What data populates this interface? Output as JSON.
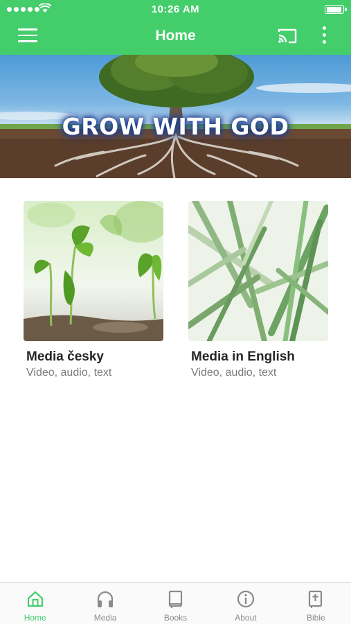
{
  "status_bar": {
    "time": "10:26 AM"
  },
  "header": {
    "title": "Home",
    "menu_icon": "hamburger-icon",
    "cast_icon": "cast-icon",
    "more_icon": "more-vertical-icon"
  },
  "banner": {
    "text": "GROW WITH GOD"
  },
  "cards": [
    {
      "title": "Media česky",
      "subtitle": "Video, audio, text"
    },
    {
      "title": "Media in English",
      "subtitle": "Video, audio, text"
    }
  ],
  "tabs": [
    {
      "label": "Home",
      "icon": "home-icon",
      "active": true
    },
    {
      "label": "Media",
      "icon": "headphones-icon",
      "active": false
    },
    {
      "label": "Books",
      "icon": "book-icon",
      "active": false
    },
    {
      "label": "About",
      "icon": "info-icon",
      "active": false
    },
    {
      "label": "Bible",
      "icon": "bible-icon",
      "active": false
    }
  ],
  "colors": {
    "accent": "#44cd6b",
    "tab_inactive": "#8a8a8a"
  }
}
